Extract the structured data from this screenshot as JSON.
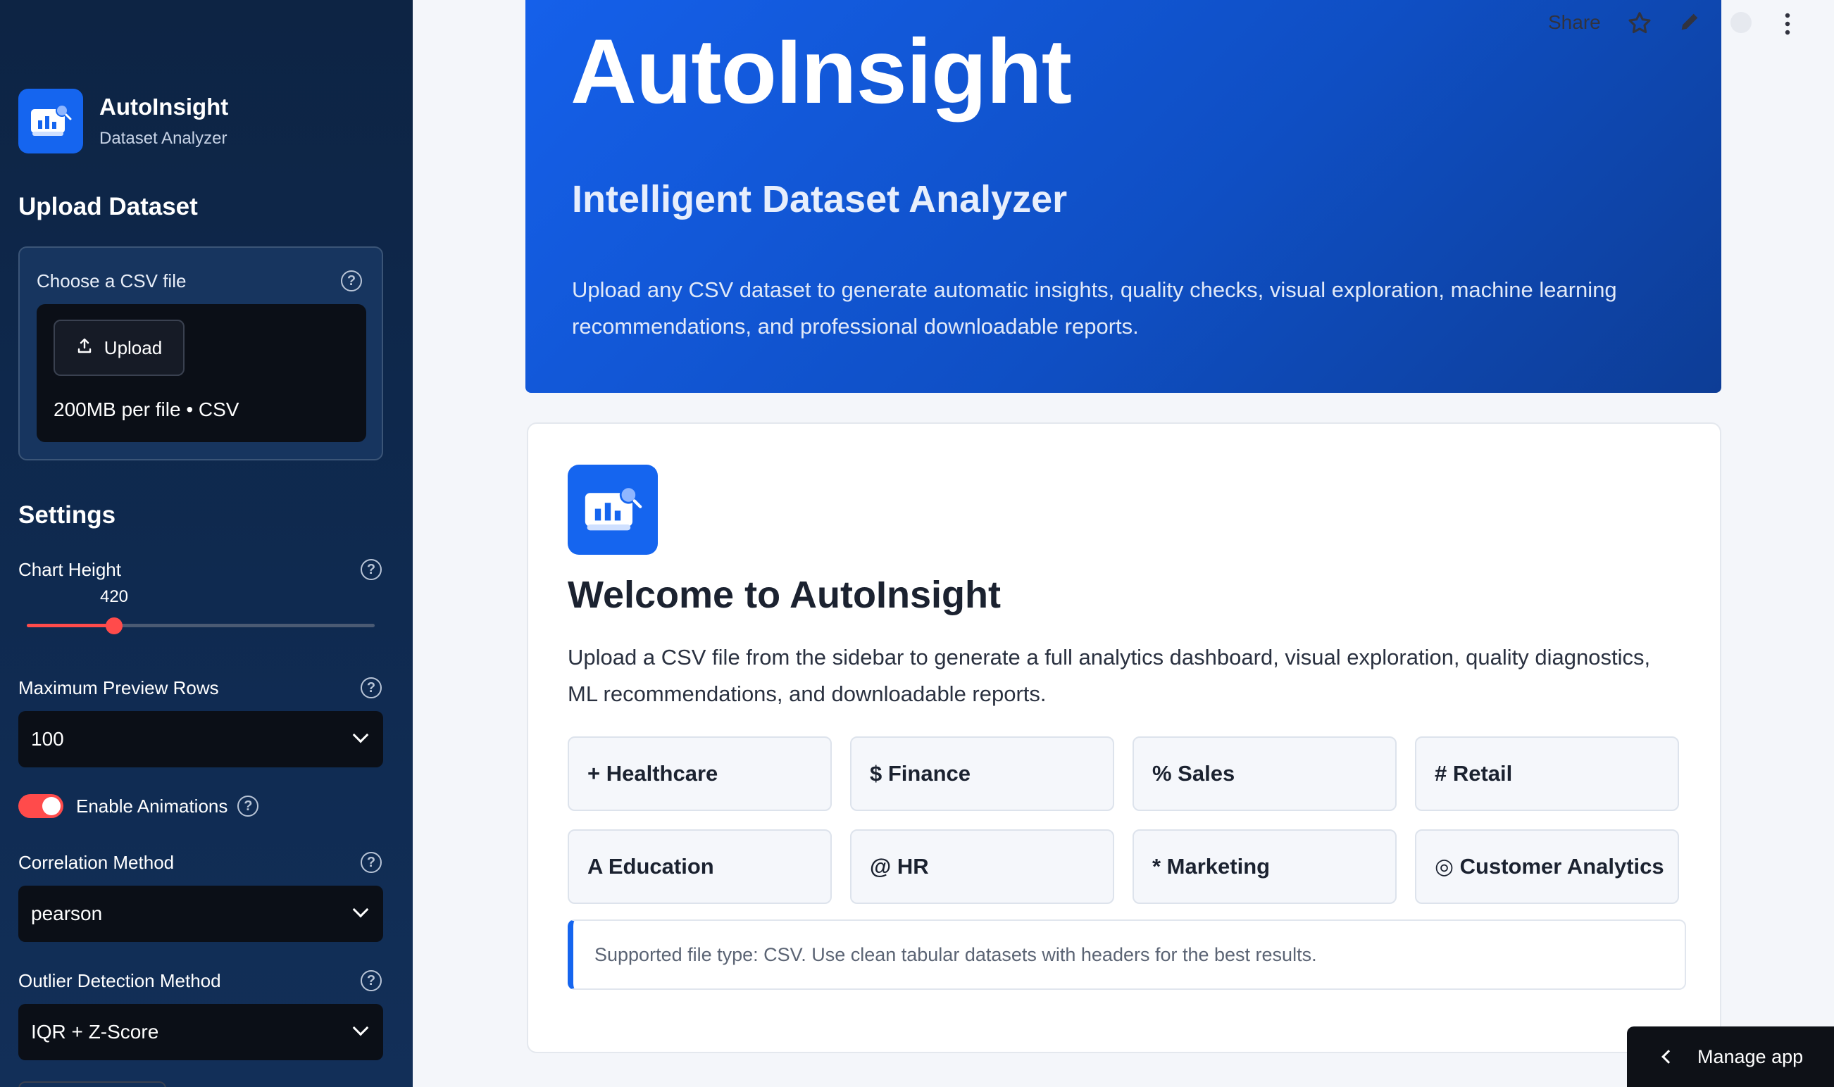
{
  "sidebar": {
    "brand": {
      "name": "AutoInsight",
      "subtitle": "Dataset Analyzer"
    },
    "upload_heading": "Upload Dataset",
    "uploader": {
      "label": "Choose a CSV file",
      "button": "Upload",
      "limits": "200MB per file • CSV"
    },
    "settings_heading": "Settings",
    "chart_height": {
      "label": "Chart Height",
      "value": 420,
      "value_text": "420",
      "fraction": 0.25
    },
    "max_preview_rows": {
      "label": "Maximum Preview Rows",
      "value": "100"
    },
    "animations": {
      "label": "Enable Animations",
      "enabled": true
    },
    "correlation": {
      "label": "Correlation Method",
      "value": "pearson"
    },
    "outlier": {
      "label": "Outlier Detection Method",
      "value": "IQR + Z-Score"
    }
  },
  "toolbar": {
    "share": "Share",
    "icons": [
      "star-icon",
      "pencil-icon",
      "github-icon",
      "more-vertical-icon"
    ]
  },
  "hero": {
    "title": "AutoInsight",
    "subtitle": "Intelligent Dataset Analyzer",
    "description": "Upload any CSV dataset to generate automatic insights, quality checks, visual exploration, machine learning recommendations, and professional downloadable reports."
  },
  "welcome": {
    "title": "Welcome to AutoInsight",
    "description": "Upload a CSV file from the sidebar to generate a full analytics dashboard, visual exploration, quality diagnostics, ML recommendations, and downloadable reports.",
    "chips": [
      "+ Healthcare",
      "$ Finance",
      "% Sales",
      "# Retail",
      "A Education",
      "@ HR",
      "* Marketing",
      "◎ Customer Analytics"
    ],
    "note": "Supported file type: CSV. Use clean tabular datasets with headers for the best results."
  },
  "manage_app": "Manage app",
  "colors": {
    "sidebar_bg": "#0f2a50",
    "accent": "#1565ef",
    "slider_accent": "#ff4b4b",
    "hero_start": "#1560ea",
    "hero_end": "#0d3d96"
  }
}
